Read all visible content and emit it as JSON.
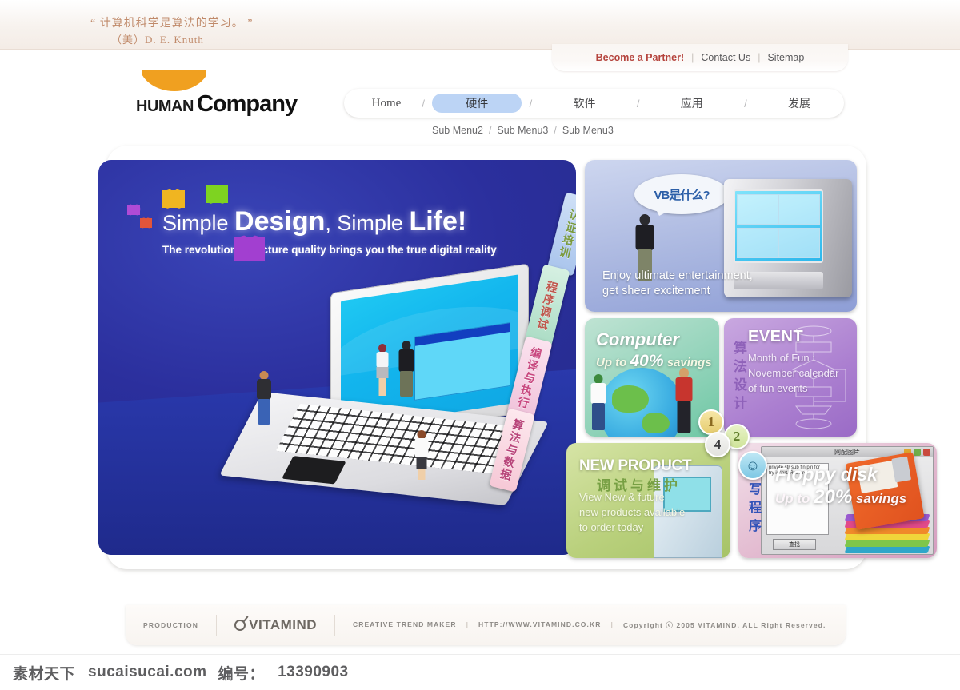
{
  "topbar": {
    "quote_line1": "“ 计算机科学是算法的学习。 ”",
    "quote_line2": "（美）D. E. Knuth"
  },
  "utility": {
    "partner": "Become a Partner!",
    "sep1": "|",
    "contact": "Contact Us",
    "sep2": "|",
    "sitemap": "Sitemap"
  },
  "logo": {
    "human": "HUMAN",
    "company": "Company",
    "icon": "orange-smile-arc"
  },
  "nav": {
    "items": [
      {
        "label": "Home",
        "active": false
      },
      {
        "label": "硬件",
        "active": true
      },
      {
        "label": "软件",
        "active": false
      },
      {
        "label": "应用",
        "active": false
      },
      {
        "label": "发展",
        "active": false
      }
    ],
    "separator": "/",
    "active_color": "#bcd4f5"
  },
  "submenu": {
    "items": [
      "Sub Menu2",
      "Sub Menu3",
      "Sub Menu3"
    ],
    "separator": "/"
  },
  "hero": {
    "headline_parts": [
      "Simple ",
      "Design",
      ", ",
      "Simple ",
      "Life!"
    ],
    "headline_plain": "Simple Design, Simple Life!",
    "subhead": "The revolution in picture quality brings you the true digital reality",
    "bg_color": "#2b2f9d"
  },
  "side_tabs": [
    {
      "label": "认证培训",
      "color": "#bcd4f5",
      "text_color": "#7a9a3c"
    },
    {
      "label": "程序调试",
      "color": "#aadcc4",
      "text_color": "#c0564c"
    },
    {
      "label": "编译与执行",
      "color": "#f0c2da",
      "text_color": "#c8487f"
    },
    {
      "label": "算法与数据",
      "color": "#f6c8d6",
      "text_color": "#b8457a"
    }
  ],
  "panels": {
    "tv": {
      "bubble_text": "VB是什么?",
      "caption_line1": "Enjoy ultimate entertainment,",
      "caption_line2": "get sheer excitement",
      "bg_color": "#aab7e0"
    },
    "computer": {
      "title": "Computer",
      "sub_prefix": "Up to ",
      "sub_value": "40%",
      "sub_suffix": " savings",
      "bg_color": "#8fd2b8"
    },
    "event": {
      "title": "EVENT",
      "line1": "Month of Fun :",
      "line2": "November calendar",
      "line3": "of fun events",
      "cn_text": "算法设计",
      "bg_color": "#ab7fd0"
    },
    "new_product": {
      "title": "NEW PRODUCT",
      "cn_text": "调试与维护",
      "line1": "View New & future",
      "line2": "new products available",
      "line3": "to order today",
      "bg_color": "#b9d07c"
    },
    "floppy": {
      "title": "Floppy disk",
      "sub_prefix": "Up to ",
      "sub_value": "20%",
      "sub_suffix": " savings",
      "cn_text": "编写程序",
      "window_title": "网配图片",
      "list_items": "private\nstr\nsub\nfin\npin\nfor\ntry\ninsert. Require",
      "button_label": "查找",
      "bg_color": "#d59dbf"
    }
  },
  "badges": [
    {
      "label": "1"
    },
    {
      "label": "2"
    },
    {
      "label": "4"
    },
    {
      "label": "☺"
    }
  ],
  "footer": {
    "production": "PRODUCTION",
    "brand": "VITAMIND",
    "tagline": "CREATIVE TREND MAKER",
    "bar1": "|",
    "url": "HTTP://WWW.VITAMIND.CO.KR",
    "bar2": "|",
    "copyright": "Copyright ⓒ 2005 VITAMIND. ALL Right Reserved."
  },
  "watermark": {
    "site_cn": "素材天下",
    "site_en": "sucaisucai.com",
    "id_label": "编号：",
    "id_value": "13390903"
  }
}
